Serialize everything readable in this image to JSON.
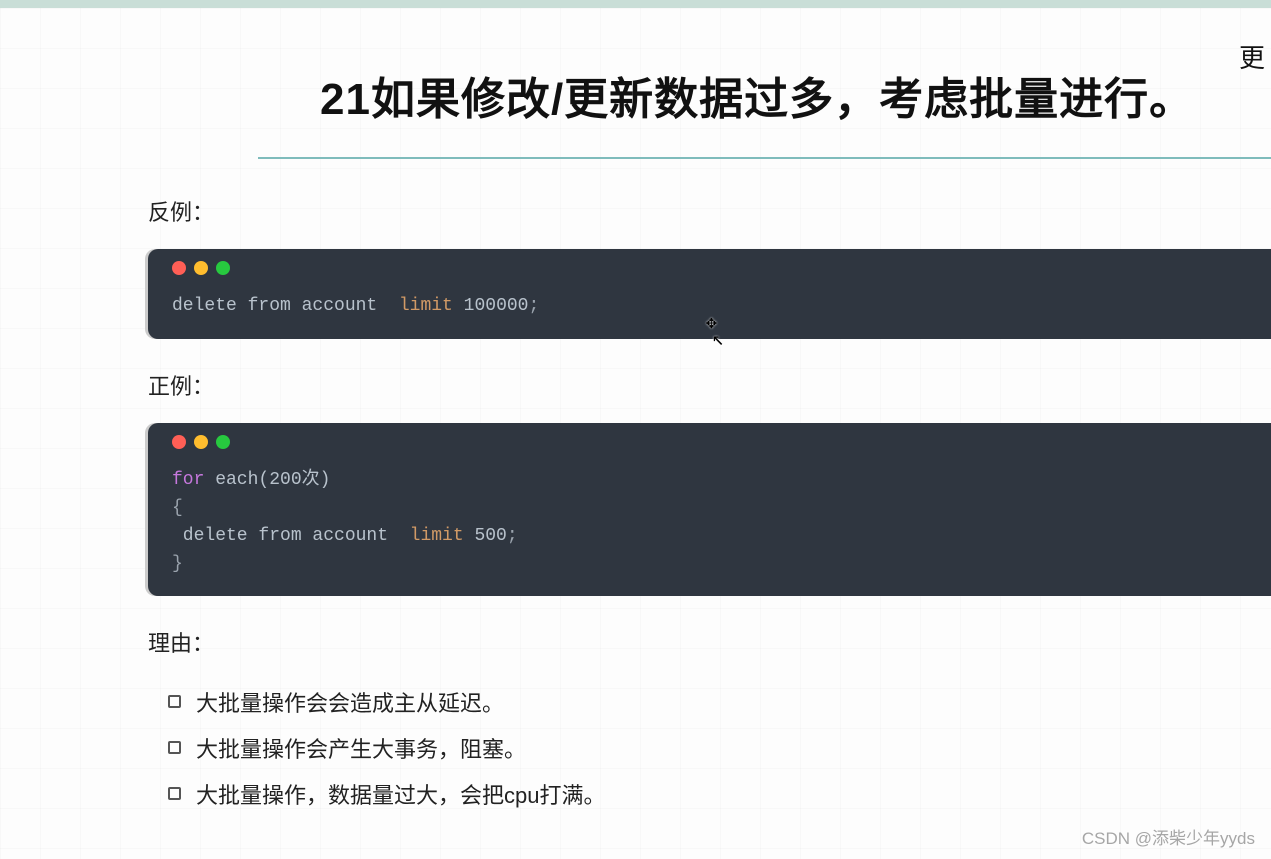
{
  "top_right_link": "更",
  "title": "21如果修改/更新数据过多，考虑批量进行。",
  "labels": {
    "bad": "反例：",
    "good": "正例：",
    "reason": "理由："
  },
  "code_bad": {
    "tokens": [
      {
        "t": "delete from account  ",
        "c": "plain"
      },
      {
        "t": "limit",
        "c": "orange"
      },
      {
        "t": " 100000",
        "c": "num"
      },
      {
        "t": ";",
        "c": "punct"
      }
    ]
  },
  "code_good": {
    "lines": [
      [
        {
          "t": "for",
          "c": "pink"
        },
        {
          "t": " each(200次)",
          "c": "plain"
        }
      ],
      [
        {
          "t": "{",
          "c": "punct"
        }
      ],
      [
        {
          "t": " delete from account  ",
          "c": "plain"
        },
        {
          "t": "limit",
          "c": "orange"
        },
        {
          "t": " 500",
          "c": "num"
        },
        {
          "t": ";",
          "c": "punct"
        }
      ],
      [
        {
          "t": "}",
          "c": "punct"
        }
      ]
    ]
  },
  "reasons": [
    "大批量操作会会造成主从延迟。",
    "大批量操作会产生大事务，阻塞。",
    "大批量操作，数据量过大，会把cpu打满。"
  ],
  "watermark": "CSDN @添柴少年yyds"
}
